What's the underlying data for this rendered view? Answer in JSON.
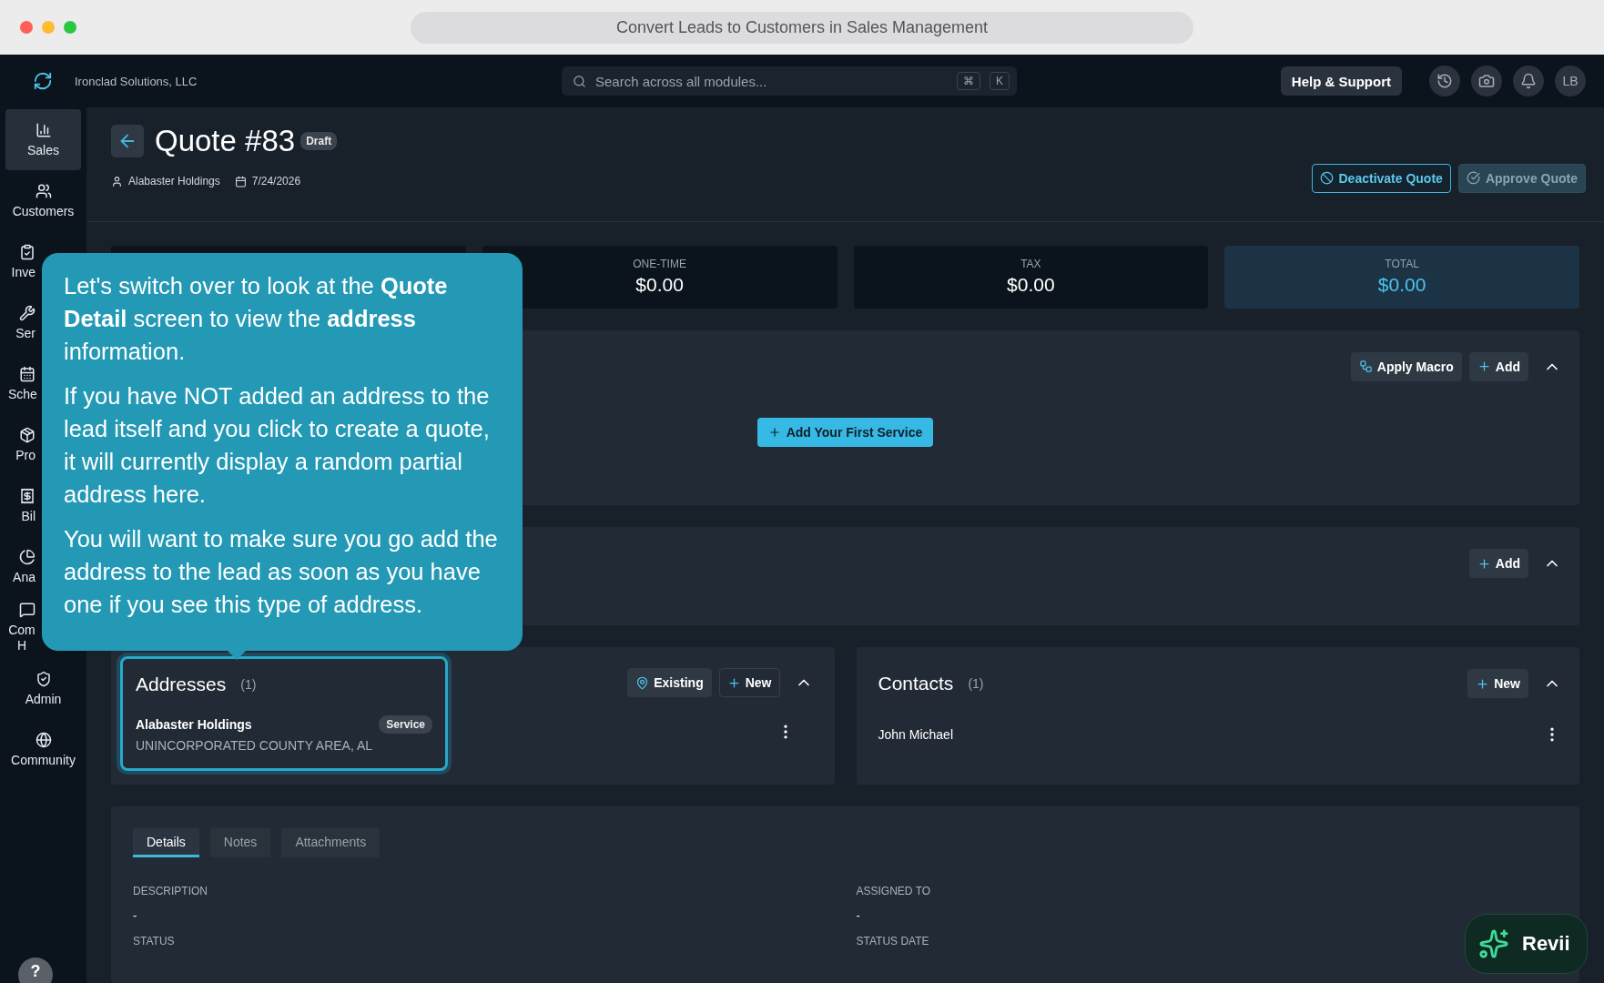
{
  "window": {
    "title": "Convert Leads to Customers in Sales Management"
  },
  "topbar": {
    "company": "Ironclad Solutions, LLC",
    "search": {
      "placeholder": "Search across all modules...",
      "shortcut": [
        "⌘",
        "K"
      ]
    },
    "help": "Help & Support",
    "avatar": "LB"
  },
  "sidebar": {
    "items": [
      {
        "label": "Sales",
        "selected": true,
        "kind": "full"
      },
      {
        "label": "Customers",
        "selected": false,
        "kind": "full"
      },
      {
        "label": "Inve",
        "selected": false,
        "kind": "covered"
      },
      {
        "label": "Ser",
        "selected": false,
        "kind": "covered"
      },
      {
        "label": "Sche",
        "selected": false,
        "kind": "covered"
      },
      {
        "label": "Pro",
        "selected": false,
        "kind": "covered"
      },
      {
        "label": "Bil",
        "selected": false,
        "kind": "covered"
      },
      {
        "label": "Ana",
        "selected": false,
        "kind": "covered"
      },
      {
        "label": "Com H",
        "selected": false,
        "kind": "covered"
      },
      {
        "label": "Admin",
        "selected": false,
        "kind": "full"
      },
      {
        "label": "Community",
        "selected": false,
        "kind": "full"
      }
    ]
  },
  "quote": {
    "title": "Quote #83",
    "status": "Draft",
    "customer": "Alabaster Holdings",
    "date": "7/24/2026",
    "actions": [
      {
        "label": "Deactivate Quote",
        "disabled": false
      },
      {
        "label": "Approve Quote",
        "disabled": true
      }
    ]
  },
  "totals": [
    {
      "label": "ONE-TIME",
      "value": "$0.00",
      "highlight": false
    },
    {
      "label": "TAX",
      "value": "$0.00",
      "highlight": false
    },
    {
      "label": "TOTAL",
      "value": "$0.00",
      "highlight": true
    }
  ],
  "services": {
    "buttons": [
      {
        "label": "Apply Macro",
        "kind": "macro"
      },
      {
        "label": "Add",
        "kind": "add"
      }
    ],
    "empty_action": "Add Your First Service"
  },
  "panel_2": {
    "buttons": [
      {
        "label": "Add",
        "kind": "add"
      }
    ]
  },
  "addresses": {
    "title": "Addresses",
    "count": "(1)",
    "buttons": [
      {
        "label": "Existing",
        "kind": "pick"
      },
      {
        "label": "New",
        "kind": "new"
      }
    ],
    "items": [
      {
        "name": "Alabaster Holdings",
        "tag": "Service",
        "line": "UNINCORPORATED COUNTY AREA, AL",
        "highlighted": true
      }
    ]
  },
  "contacts": {
    "title": "Contacts",
    "count": "(1)",
    "buttons": [
      {
        "label": "New",
        "kind": "add"
      }
    ],
    "items": [
      {
        "name": "John Michael"
      }
    ]
  },
  "details": {
    "tabs": [
      {
        "label": "Details",
        "selected": true
      },
      {
        "label": "Notes",
        "selected": false
      },
      {
        "label": "Attachments",
        "selected": false
      }
    ],
    "fields": [
      {
        "label": "DESCRIPTION",
        "value": "-"
      },
      {
        "label": "ASSIGNED TO",
        "value": "-"
      },
      {
        "label": "STATUS"
      },
      {
        "label": "STATUS DATE"
      }
    ]
  },
  "tooltip": {
    "paragraphs": [
      "Let's switch over to look at the **Quote Detail** screen to view the **address** information.",
      "If you have NOT added an address to the lead itself and you click to create a quote, it will currently display a random partial address here.",
      "You will want to make sure you go add the address to the lead as soon as you have one if you see this type of address."
    ]
  },
  "assistant": {
    "label": "Revii"
  },
  "help_button": "?"
}
